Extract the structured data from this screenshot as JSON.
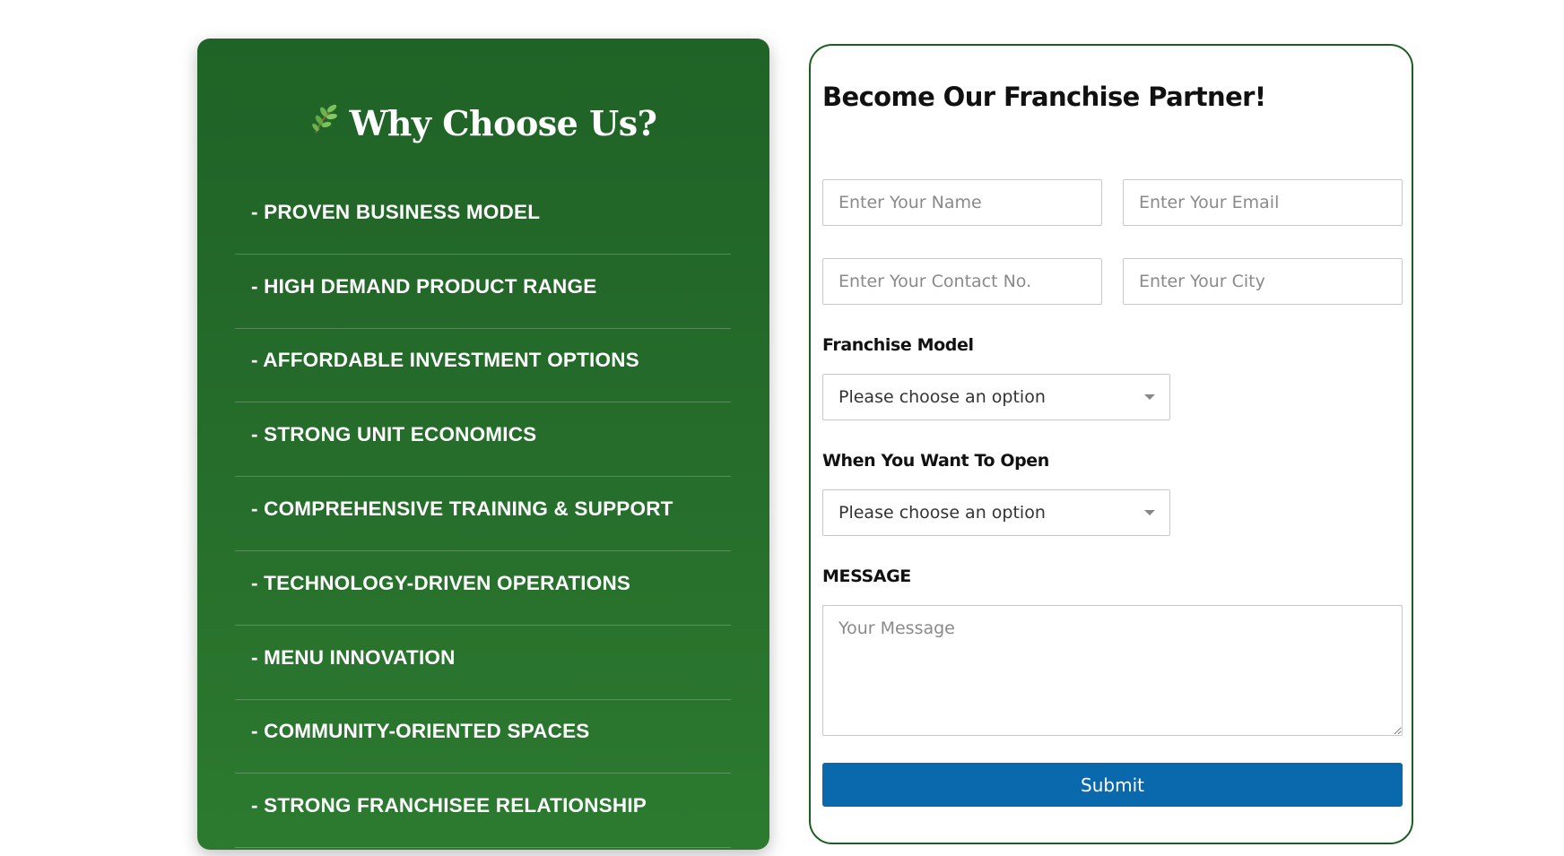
{
  "why_choose": {
    "title": "Why Choose Us?",
    "title_icon": "leaf-sprig-icon",
    "items": [
      "- PROVEN BUSINESS MODEL",
      "- HIGH DEMAND PRODUCT RANGE",
      "- AFFORDABLE INVESTMENT OPTIONS",
      "- STRONG UNIT ECONOMICS",
      "- COMPREHENSIVE TRAINING & SUPPORT",
      "- TECHNOLOGY-DRIVEN OPERATIONS",
      "- MENU INNOVATION",
      "- COMMUNITY-ORIENTED SPACES",
      "- STRONG FRANCHISEE RELATIONSHIP"
    ],
    "background_color": "#236829",
    "text_color": "#ffffff"
  },
  "form": {
    "title": "Become Our Franchise Partner!",
    "name_placeholder": "Enter Your Name",
    "email_placeholder": "Enter Your Email",
    "contact_placeholder": "Enter Your Contact No.",
    "city_placeholder": "Enter Your City",
    "franchise_model_label": "Franchise Model",
    "franchise_model_value": "Please choose an option",
    "open_when_label": "When You Want To Open",
    "open_when_value": "Please choose an option",
    "message_label": "MESSAGE",
    "message_placeholder": "Your Message",
    "submit_label": "Submit",
    "border_color": "#1b5e20",
    "submit_color": "#0a69ad"
  }
}
